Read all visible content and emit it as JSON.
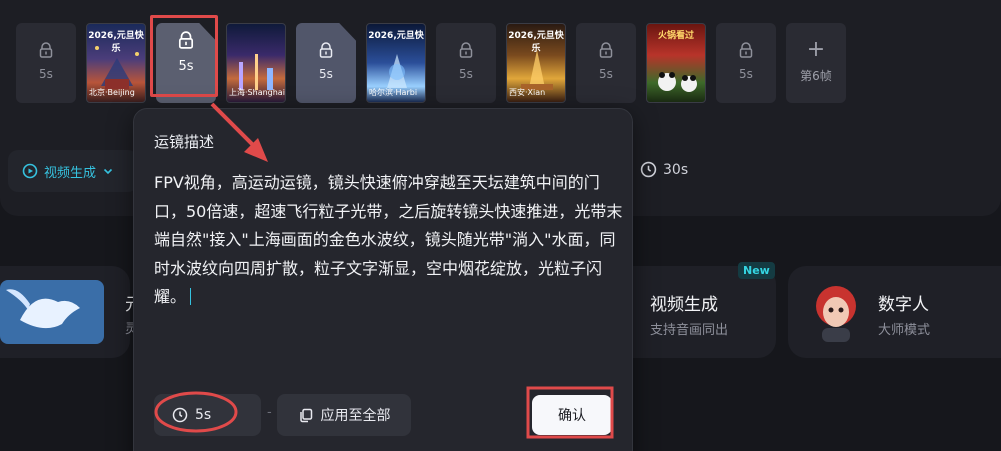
{
  "frames": [
    {
      "kind": "placeholder",
      "duration": "5s"
    },
    {
      "kind": "image",
      "caption_top": "2026,元旦快乐",
      "caption_bottom": "北京·Beijing"
    },
    {
      "kind": "selected",
      "duration": "5s"
    },
    {
      "kind": "image",
      "caption_top": "",
      "caption_bottom": "上海·Shanghai"
    },
    {
      "kind": "placeholder-blue",
      "duration": "5s"
    },
    {
      "kind": "image",
      "caption_top": "2026,元旦快",
      "caption_bottom": "哈尔滨·Harbi"
    },
    {
      "kind": "placeholder",
      "duration": "5s"
    },
    {
      "kind": "image",
      "caption_top": "2026,元旦快乐",
      "caption_bottom": "西安·Xian"
    },
    {
      "kind": "placeholder",
      "duration": "5s"
    },
    {
      "kind": "image",
      "caption_top": "火锅看过",
      "caption_bottom": ""
    },
    {
      "kind": "placeholder",
      "duration": "5s"
    }
  ],
  "add_frame": {
    "plus": "+",
    "label": "第6帧"
  },
  "mode": {
    "label": "视频生成",
    "icon": "video-play-icon"
  },
  "total_duration": "30s",
  "cards": {
    "left": {
      "title": "元",
      "sub": "灵"
    },
    "video": {
      "title": "视频生成",
      "sub": "支持音画同出",
      "badge": "New"
    },
    "human": {
      "title": "数字人",
      "sub": "大师模式"
    }
  },
  "popover": {
    "title": "运镜描述",
    "text": "FPV视角，高运动运镜，镜头快速俯冲穿越至天坛建筑中间的门口，50倍速，超速飞行粒子光带，之后旋转镜头快速推进，光带末端自然\"接入\"上海画面的金色水波纹，镜头随光带\"淌入\"水面，同时水波纹向四周扩散，粒子文字渐显，空中烟花绽放，光粒子闪耀。",
    "duration": "5s",
    "separator": "-",
    "apply_all": "应用至全部",
    "confirm": "确认"
  },
  "colors": {
    "accent": "#36c2df",
    "annotation": "#e04a4a",
    "background": "#16171c"
  }
}
